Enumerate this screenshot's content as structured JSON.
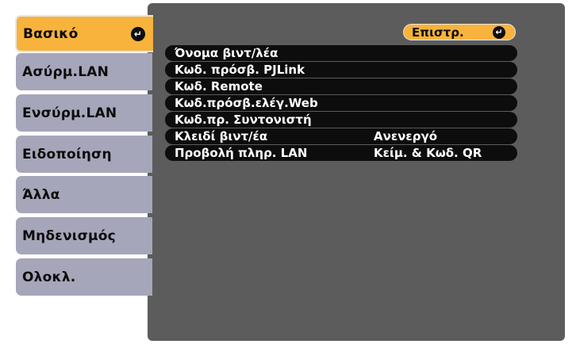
{
  "tabs": [
    {
      "label": "Βασικό",
      "active": true
    },
    {
      "label": "Ασύρμ.LAN",
      "active": false
    },
    {
      "label": "Ενσύρμ.LAN",
      "active": false
    },
    {
      "label": "Ειδοποίηση",
      "active": false
    },
    {
      "label": "Άλλα",
      "active": false
    },
    {
      "label": "Μηδενισμός",
      "active": false
    },
    {
      "label": "Ολοκλ.",
      "active": false
    }
  ],
  "back_button": {
    "label": "Επιστρ."
  },
  "enter_icon_glyph": "↵",
  "settings": [
    {
      "label": "Όνομα βιντ/λέα",
      "value": ""
    },
    {
      "label": "Κωδ. πρόσβ. PJLink",
      "value": ""
    },
    {
      "label": "Κωδ. Remote",
      "value": ""
    },
    {
      "label": "Κωδ.πρόσβ.ελέγ.Web",
      "value": ""
    },
    {
      "label": "Κωδ.πρ. Συντονιστή",
      "value": ""
    },
    {
      "label": "Κλειδί βιντ/έα",
      "value": "Ανενεργό"
    },
    {
      "label": "Προβολή πληρ. LAN",
      "value": "Κείμ. & Κωδ. QR"
    }
  ],
  "colors": {
    "accent": "#f7b33b",
    "tab": "#a6a6ba",
    "panel": "#5c5c5c",
    "row": "#0d0d0d"
  }
}
